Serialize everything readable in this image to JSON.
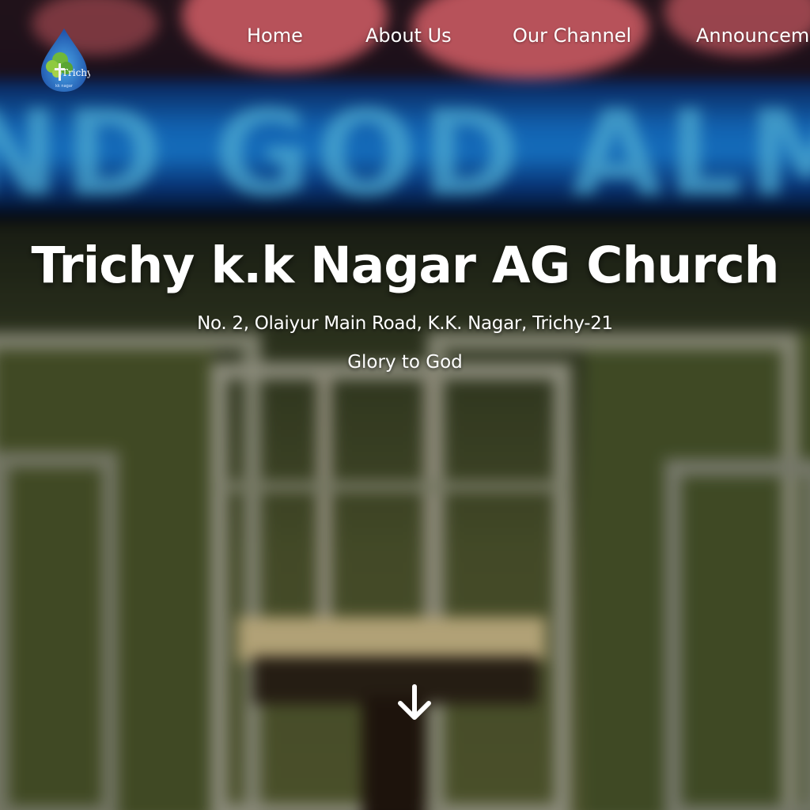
{
  "colors": {
    "text": "#ffffff",
    "neon_blue": "#1a86e6",
    "wall_green": "#525a30",
    "frame_gray": "#a8a894"
  },
  "logo": {
    "icon": "church-logo-icon",
    "text": "Trichy",
    "subtext": "kk nagar"
  },
  "nav": {
    "items": [
      {
        "label": "Home"
      },
      {
        "label": "About Us"
      },
      {
        "label": "Our Channel"
      },
      {
        "label": "Announcements"
      }
    ]
  },
  "background": {
    "sign_text": "ND GOD ALMIGHTY"
  },
  "hero": {
    "title": "Trichy k.k Nagar AG Church",
    "address": "No. 2, Olaiyur Main Road, K.K. Nagar, Trichy-21",
    "tagline": "Glory to God",
    "scroll_icon": "arrow-down-icon"
  }
}
